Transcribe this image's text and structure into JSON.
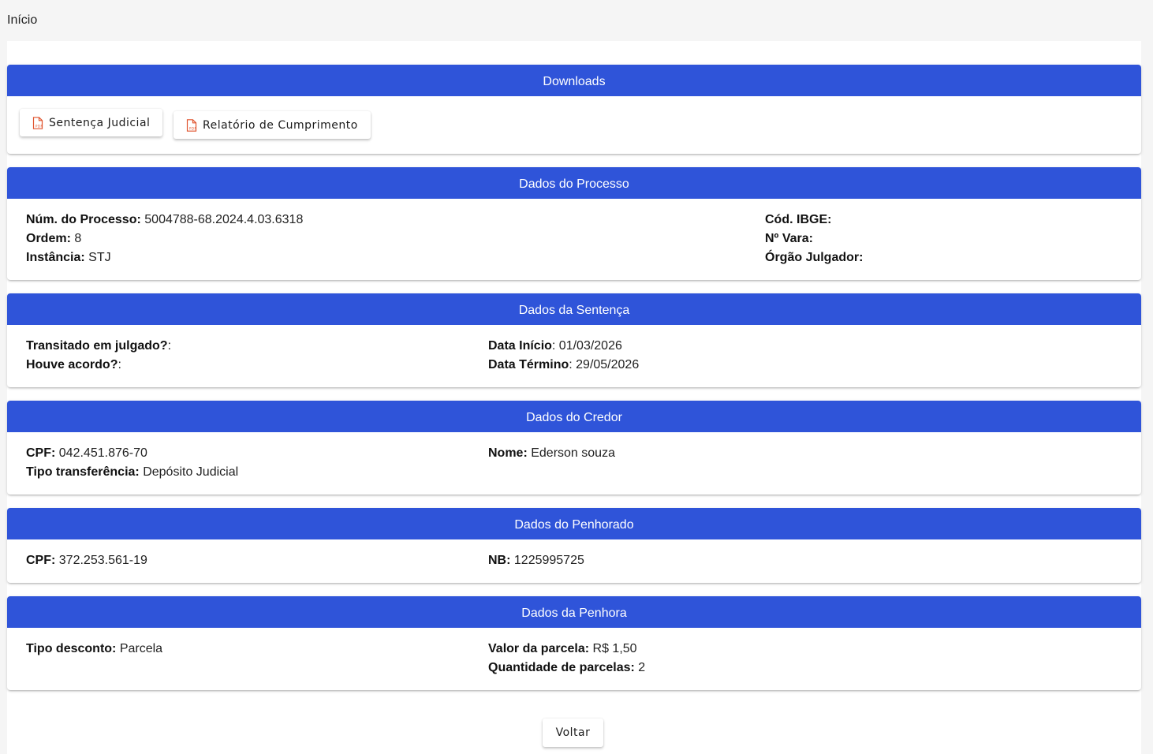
{
  "breadcrumb": {
    "label": "Início"
  },
  "downloads": {
    "title": "Downloads",
    "buttons": [
      {
        "label": "Sentença Judicial",
        "icon": "pdf-file-icon"
      },
      {
        "label": "Relatório de Cumprimento",
        "icon": "pdf-file-icon"
      }
    ]
  },
  "processo": {
    "title": "Dados do Processo",
    "num_label": "Núm. do Processo:",
    "num_value": "5004788-68.2024.4.03.6318",
    "ordem_label": "Ordem:",
    "ordem_value": "8",
    "instancia_label": "Instância:",
    "instancia_value": "STJ",
    "ibge_label": "Cód. IBGE:",
    "ibge_value": "",
    "vara_label": "Nº Vara:",
    "vara_value": "",
    "orgao_label": "Órgão Julgador:",
    "orgao_value": ""
  },
  "sentenca": {
    "title": "Dados da Sentença",
    "transitado_label": "Transitado em julgado?",
    "transitado_value": "",
    "acordo_label": "Houve acordo?",
    "acordo_value": "",
    "inicio_label": "Data Início",
    "inicio_value": "01/03/2026",
    "termino_label": "Data Término",
    "termino_value": "29/05/2026"
  },
  "credor": {
    "title": "Dados do Credor",
    "cpf_label": "CPF:",
    "cpf_value": "042.451.876-70",
    "tipo_label": "Tipo transferência:",
    "tipo_value": "Depósito Judicial",
    "nome_label": "Nome:",
    "nome_value": "Ederson souza"
  },
  "penhorado": {
    "title": "Dados do Penhorado",
    "cpf_label": "CPF:",
    "cpf_value": "372.253.561-19",
    "nb_label": "NB:",
    "nb_value": "1225995725"
  },
  "penhora": {
    "title": "Dados da Penhora",
    "tipo_label": "Tipo desconto:",
    "tipo_value": "Parcela",
    "valor_label": "Valor da parcela:",
    "valor_value": "R$ 1,50",
    "qtd_label": "Quantidade de parcelas:",
    "qtd_value": "2"
  },
  "actions": {
    "voltar_label": "Voltar"
  },
  "colors": {
    "header": "#2f54d9",
    "pdf_icon": "#e0542e"
  }
}
